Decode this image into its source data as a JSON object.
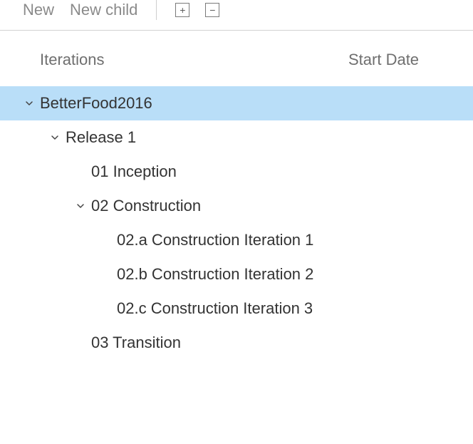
{
  "toolbar": {
    "new_label": "New",
    "new_child_label": "New child"
  },
  "columns": {
    "iterations": "Iterations",
    "start_date": "Start Date"
  },
  "tree": {
    "root": {
      "label": "BetterFood2016",
      "children": {
        "release1": {
          "label": "Release 1",
          "items": {
            "inception": "01 Inception",
            "construction": {
              "label": "02 Construction",
              "children": {
                "a": "02.a Construction Iteration 1",
                "b": "02.b Construction Iteration 2",
                "c": "02.c Construction Iteration 3"
              }
            },
            "transition": "03 Transition"
          }
        }
      }
    }
  }
}
